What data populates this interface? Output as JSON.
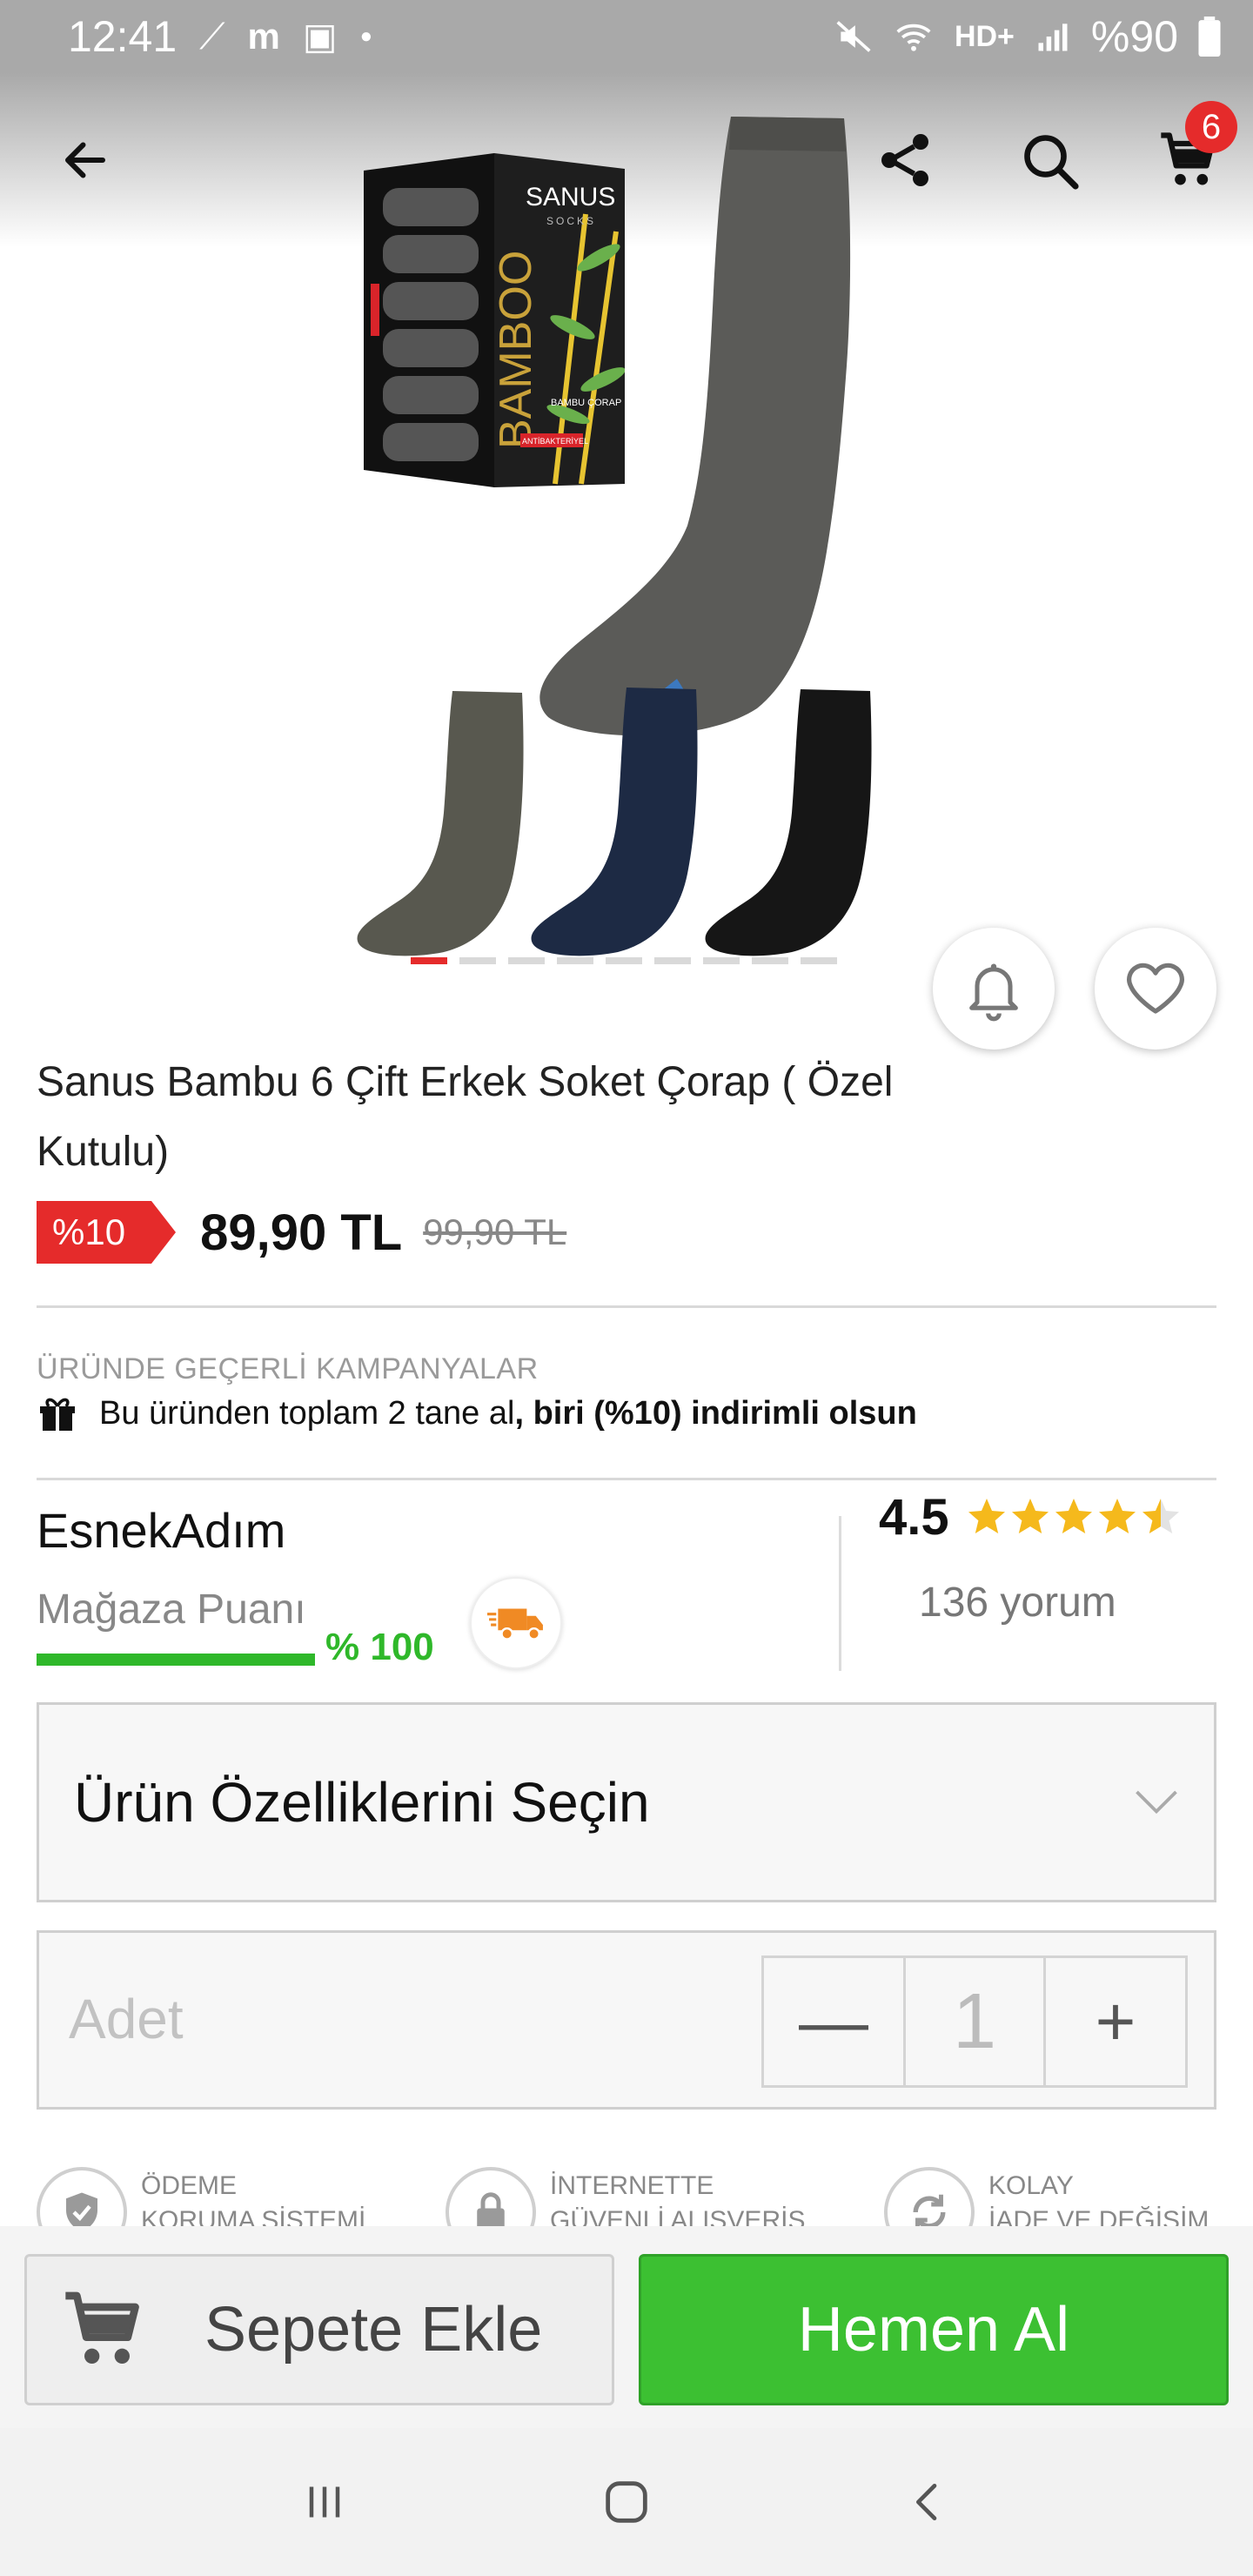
{
  "status_bar": {
    "time": "12:41",
    "carrier_text": "HD+",
    "battery": "%90"
  },
  "app_bar": {
    "cart_count": "6"
  },
  "product_images": {
    "box_brand": "SANUS",
    "box_subtitle": "SOCKS",
    "box_text": "BAMBOO",
    "box_label": "BAMBU ÇORAP",
    "box_tag": "ANTİBAKTERİYEL"
  },
  "product": {
    "title": "Sanus Bambu 6 Çift Erkek Soket Çorap ( Özel Kutulu)",
    "discount": "%10",
    "price": "89,90 TL",
    "old_price": "99,90 TL"
  },
  "campaign": {
    "heading": "ÜRÜNDE GEÇERLİ KAMPANYALAR",
    "text_normal": "Bu üründen toplam 2 tane al",
    "text_bold": ", biri (%10) indirimli olsun"
  },
  "store": {
    "name": "EsnekAdım",
    "score_label": "Mağaza Puanı",
    "score_value": "% 100",
    "score_fraction": 1.0,
    "rating": "4.5",
    "rating_value": 4.5,
    "reviews": "136 yorum"
  },
  "options": {
    "select_label": "Ürün Özelliklerini Seçin"
  },
  "quantity": {
    "label": "Adet",
    "value": "1",
    "minus": "—",
    "plus": "+"
  },
  "badges": [
    {
      "line1": "ÖDEME",
      "line2": "KORUMA SİSTEMİ"
    },
    {
      "line1": "İNTERNETTE",
      "line2": "GÜVENLİ ALIŞVERİŞ"
    },
    {
      "line1": "KOLAY",
      "line2": "İADE VE DEĞİŞİM"
    }
  ],
  "actions": {
    "add_to_cart": "Sepete Ekle",
    "buy_now": "Hemen Al"
  },
  "colors": {
    "accent_red": "#e52b2b",
    "accent_green": "#3cc032",
    "star_yellow": "#f5b91c"
  },
  "icons": [
    "back-arrow-icon",
    "share-icon",
    "search-icon",
    "cart-icon",
    "bell-icon",
    "heart-icon",
    "gift-icon",
    "truck-icon",
    "chevron-down-icon",
    "shield-icon",
    "lock-icon",
    "refresh-icon",
    "recent-apps-icon",
    "home-icon",
    "nav-back-icon"
  ]
}
